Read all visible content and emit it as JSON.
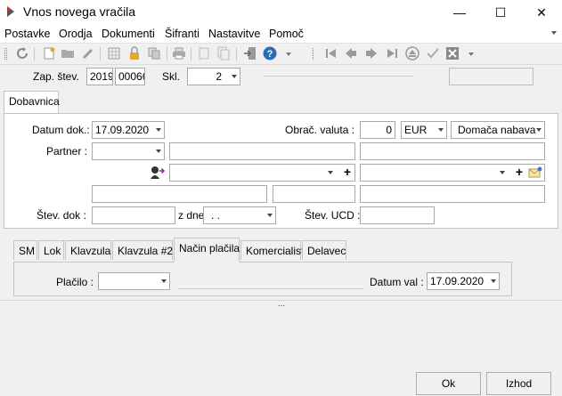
{
  "window": {
    "title": "Vnos novega vračila",
    "minimize": "—",
    "maximize": "☐",
    "close": "✕"
  },
  "menu": [
    "Postavke",
    "Orodja",
    "Dokumenti",
    "Šifranti",
    "Nastavitve",
    "Pomoč"
  ],
  "header": {
    "zap_label": "Zap. štev.",
    "year": "2019",
    "number": "00066",
    "skl_label": "Skl.",
    "skl_value": "2"
  },
  "main_tab": "Dobavnica",
  "form": {
    "datum_label": "Datum dok.:",
    "datum_value": "17.09.2020",
    "valuta_label": "Obrač. valuta :",
    "valuta_rate": "0",
    "valuta_code": "EUR",
    "nabava": "Domača nabava",
    "partner_label": "Partner :",
    "stev_dok_label": "Štev. dok :",
    "z_dne_label": "z dne",
    "z_dne_value": ". .",
    "stev_ucd_label": "Štev. UCD :"
  },
  "sub_tabs": [
    "SM",
    "Lok",
    "Klavzula",
    "Klavzula #2",
    "Način plačila",
    "Komercialist",
    "Delavec"
  ],
  "sub_active": "Način plačila",
  "payment": {
    "placilo_label": "Plačilo :",
    "datum_val_label": "Datum val :",
    "datum_val_value": "17.09.2020"
  },
  "ellipsis": "...",
  "buttons": {
    "ok": "Ok",
    "exit": "Izhod"
  }
}
